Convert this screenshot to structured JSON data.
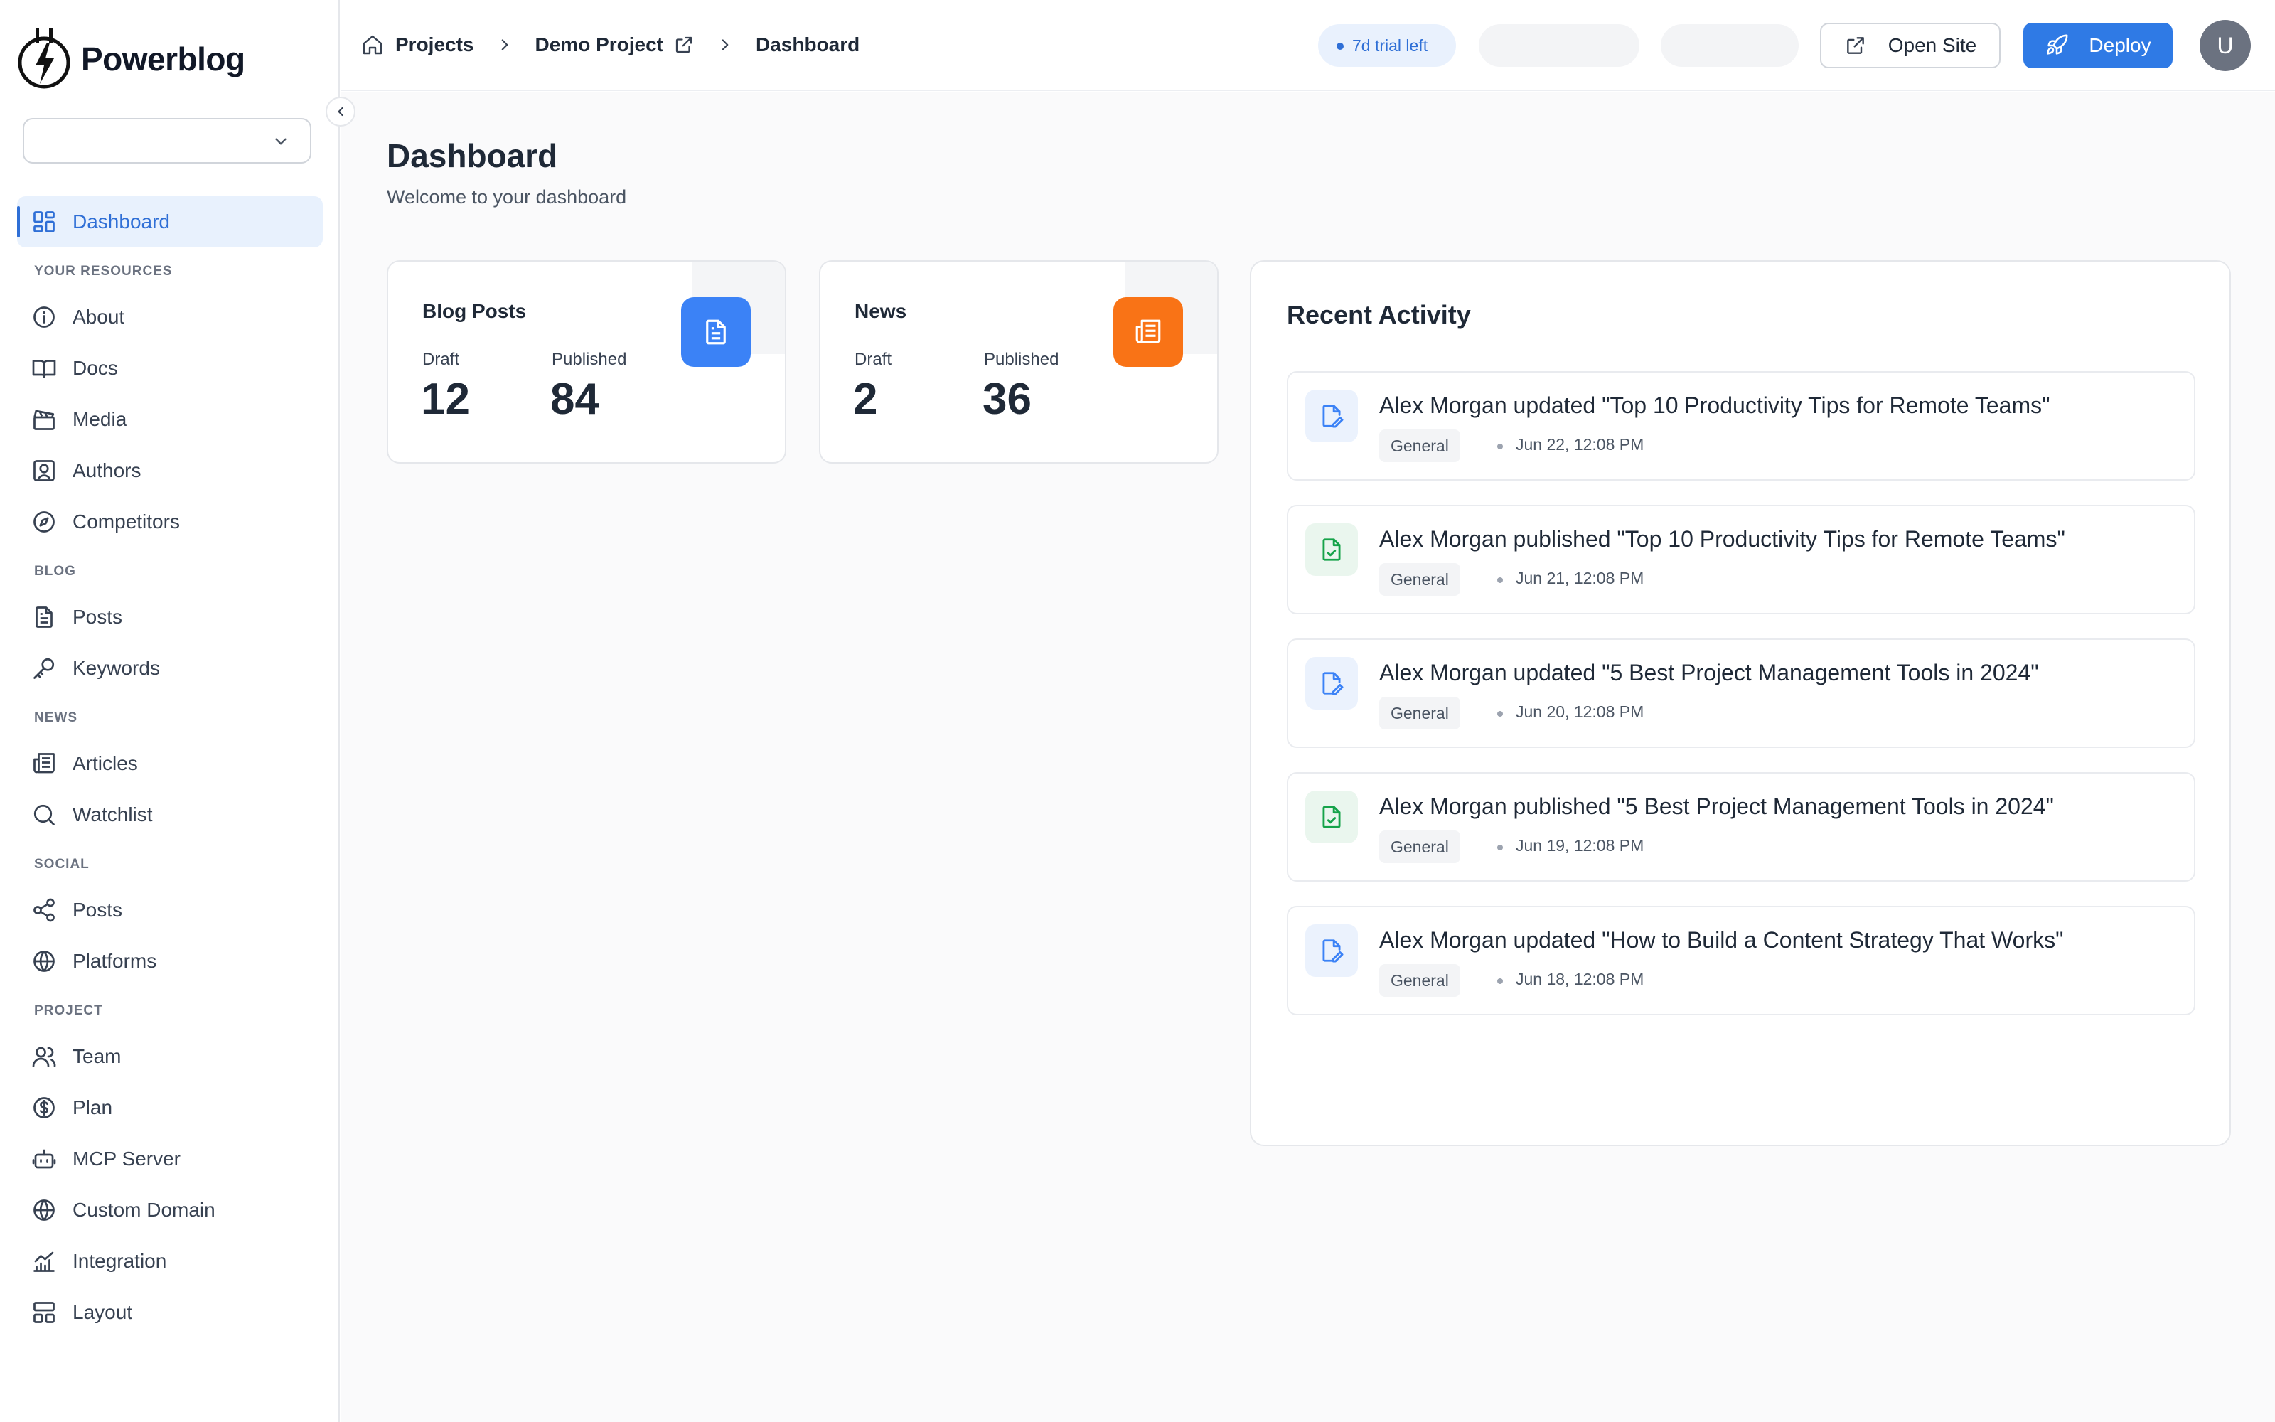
{
  "brand": {
    "name": "Powerblog"
  },
  "sidebar": {
    "project_select_value": "",
    "dashboard": "Dashboard",
    "sections": [
      {
        "title": "YOUR RESOURCES",
        "items": [
          "About",
          "Docs",
          "Media",
          "Authors",
          "Competitors"
        ]
      },
      {
        "title": "BLOG",
        "items": [
          "Posts",
          "Keywords"
        ]
      },
      {
        "title": "NEWS",
        "items": [
          "Articles",
          "Watchlist"
        ]
      },
      {
        "title": "SOCIAL",
        "items": [
          "Posts",
          "Platforms"
        ]
      },
      {
        "title": "PROJECT",
        "items": [
          "Team",
          "Plan",
          "MCP Server",
          "Custom Domain",
          "Integration",
          "Layout"
        ]
      }
    ]
  },
  "topbar": {
    "breadcrumb": [
      "Projects",
      "Demo Project",
      "Dashboard"
    ],
    "trial": "7d trial left",
    "open_site": "Open Site",
    "deploy": "Deploy",
    "avatar_initial": "U"
  },
  "page": {
    "title": "Dashboard",
    "subtitle": "Welcome to your dashboard"
  },
  "stats": [
    {
      "title": "Blog Posts",
      "draft_label": "Draft",
      "draft": "12",
      "published_label": "Published",
      "published": "84",
      "color": "#3b82f6",
      "icon": "document-icon"
    },
    {
      "title": "News",
      "draft_label": "Draft",
      "draft": "2",
      "published_label": "Published",
      "published": "36",
      "color": "#f97316",
      "icon": "newspaper-icon"
    }
  ],
  "activity": {
    "title": "Recent Activity",
    "items": [
      {
        "kind": "updated",
        "text": "Alex Morgan updated \"Top 10 Productivity Tips for Remote Teams\"",
        "tag": "General",
        "time": "Jun 22, 12:08 PM"
      },
      {
        "kind": "published",
        "text": "Alex Morgan published \"Top 10 Productivity Tips for Remote Teams\"",
        "tag": "General",
        "time": "Jun 21, 12:08 PM"
      },
      {
        "kind": "updated",
        "text": "Alex Morgan updated \"5 Best Project Management Tools in 2024\"",
        "tag": "General",
        "time": "Jun 20, 12:08 PM"
      },
      {
        "kind": "published",
        "text": "Alex Morgan published \"5 Best Project Management Tools in 2024\"",
        "tag": "General",
        "time": "Jun 19, 12:08 PM"
      },
      {
        "kind": "updated",
        "text": "Alex Morgan updated \"How to Build a Content Strategy That Works\"",
        "tag": "General",
        "time": "Jun 18, 12:08 PM"
      }
    ]
  },
  "colors": {
    "accent": "#2f7ae5",
    "published_icon": "#16a34a",
    "updated_icon": "#3b82f6"
  }
}
